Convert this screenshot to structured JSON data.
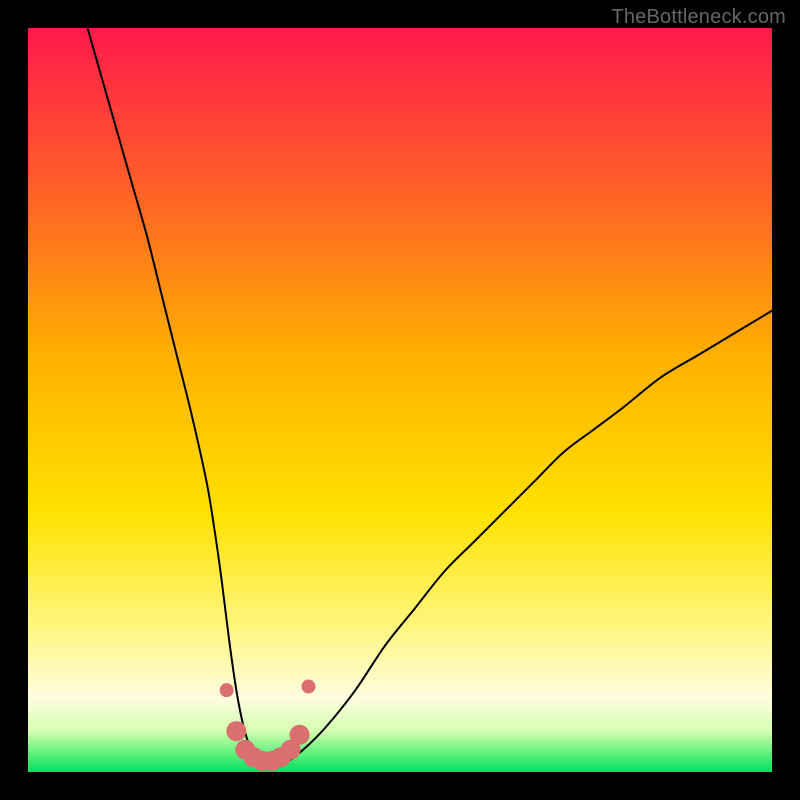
{
  "watermark": "TheBottleneck.com",
  "chart_data": {
    "type": "line",
    "title": "",
    "xlabel": "",
    "ylabel": "",
    "xlim": [
      0,
      100
    ],
    "ylim": [
      0,
      100
    ],
    "grid": false,
    "legend": false,
    "background_gradient": {
      "stops": [
        {
          "offset": 0.0,
          "color": "#ff1a4b"
        },
        {
          "offset": 0.2,
          "color": "#ff5a2a"
        },
        {
          "offset": 0.45,
          "color": "#ffb300"
        },
        {
          "offset": 0.65,
          "color": "#ffe100"
        },
        {
          "offset": 0.8,
          "color": "#fff67a"
        },
        {
          "offset": 0.9,
          "color": "#fffde0"
        },
        {
          "offset": 0.945,
          "color": "#d4ffb0"
        },
        {
          "offset": 0.975,
          "color": "#5ff07a"
        },
        {
          "offset": 1.0,
          "color": "#00e060"
        }
      ]
    },
    "series": [
      {
        "name": "bottleneck-curve",
        "stroke": "#000000",
        "stroke_width": 2,
        "x": [
          8,
          10,
          12,
          14,
          16,
          18,
          20,
          22,
          24,
          25,
          26,
          27,
          28,
          29,
          30,
          31,
          33,
          35,
          37,
          40,
          44,
          48,
          52,
          56,
          60,
          64,
          68,
          72,
          76,
          80,
          85,
          90,
          95,
          100
        ],
        "y": [
          100,
          93,
          86,
          79,
          72,
          64,
          56,
          48,
          39,
          33,
          26,
          18,
          11,
          6,
          3,
          1.5,
          1,
          1.5,
          3,
          6,
          11,
          17,
          22,
          27,
          31,
          35,
          39,
          43,
          46,
          49,
          53,
          56,
          59,
          62
        ]
      },
      {
        "name": "optimal-markers",
        "type": "scatter",
        "marker_color": "#d9706f",
        "marker_radius_main": 10,
        "marker_radius_end": 7,
        "x": [
          26.7,
          28.0,
          29.2,
          30.3,
          31.5,
          32.8,
          34.0,
          35.3,
          36.5,
          37.7
        ],
        "y": [
          11.0,
          5.5,
          3.0,
          2.0,
          1.5,
          1.5,
          2.0,
          3.0,
          5.0,
          11.5
        ]
      }
    ]
  }
}
